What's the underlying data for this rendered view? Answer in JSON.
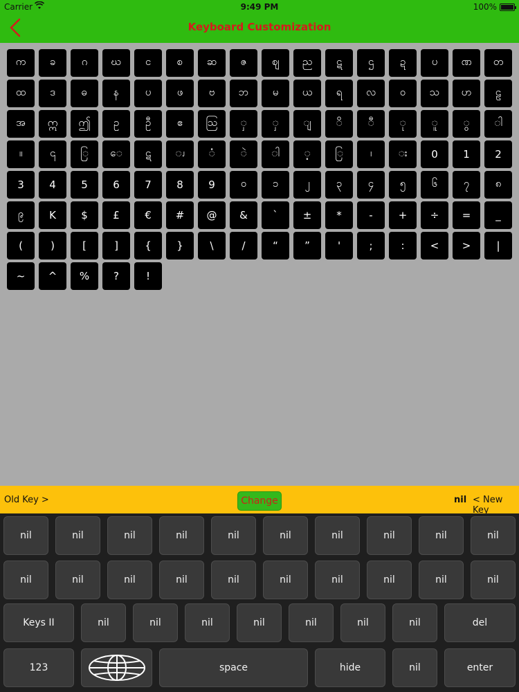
{
  "status_bar": {
    "carrier": "Carrier",
    "time": "9:49 PM",
    "battery": "100%"
  },
  "nav": {
    "title": "Keyboard Customization"
  },
  "grid": {
    "keys": [
      "က",
      "ခ",
      "ဂ",
      "ဃ",
      "င",
      "စ",
      "ဆ",
      "ဇ",
      "ဈ",
      "ည",
      "ဋ",
      "ဌ",
      "ဍ",
      "ပ",
      "ဏ",
      "တ",
      "ထ",
      "ဒ",
      "ဓ",
      "န",
      "ပ",
      "ဖ",
      "ဗ",
      "ဘ",
      "မ",
      "ယ",
      "ရ",
      "လ",
      "ဝ",
      "သ",
      "ဟ",
      "ဠ",
      "အ",
      "ဣ",
      "ဤ",
      "ဥ",
      "ဦ",
      "ဧ",
      "ဩ",
      "ှ",
      "ှ",
      "ျ",
      "ိ",
      "ီ",
      "ု",
      "ူ",
      "ွ",
      "ါ",
      "။",
      "၎",
      "ြ",
      "ေ",
      "ဋ",
      "ၪ",
      "ံ",
      "ဲ",
      "ါ",
      "့",
      "ြ",
      "၊",
      "း",
      "0",
      "1",
      "2",
      "3",
      "4",
      "5",
      "6",
      "7",
      "8",
      "9",
      "၀",
      "၁",
      "၂",
      "၃",
      "၄",
      "၅",
      "၆",
      "၇",
      "၈",
      "၉",
      "K",
      "$",
      "£",
      "€",
      "#",
      "@",
      "&",
      "`",
      "±",
      "*",
      "-",
      "+",
      "÷",
      "=",
      "_",
      "(",
      ")",
      "[",
      "]",
      "{",
      "}",
      "\\",
      "/",
      "“",
      "”",
      "'",
      ";",
      ":",
      "<",
      ">",
      "|",
      "~",
      "^",
      "%",
      "?",
      "!"
    ]
  },
  "change_bar": {
    "old_label": "Old Key >",
    "change_label": "Change",
    "new_value": "nil",
    "new_label": "< New Key"
  },
  "keyboard": {
    "row1": [
      "nil",
      "nil",
      "nil",
      "nil",
      "nil",
      "nil",
      "nil",
      "nil",
      "nil",
      "nil"
    ],
    "row2": [
      "nil",
      "nil",
      "nil",
      "nil",
      "nil",
      "nil",
      "nil",
      "nil",
      "nil",
      "nil"
    ],
    "row3": [
      "Keys II",
      "nil",
      "nil",
      "nil",
      "nil",
      "nil",
      "nil",
      "nil",
      "del"
    ],
    "row4": {
      "num": "123",
      "globe": "globe-icon",
      "space": "space",
      "hide": "hide",
      "nil": "nil",
      "enter": "enter"
    }
  },
  "colors": {
    "nav_bg": "#2fbb10",
    "title": "#d41c1c",
    "change_bar": "#fdc10b",
    "change_button": "#34b81c"
  }
}
